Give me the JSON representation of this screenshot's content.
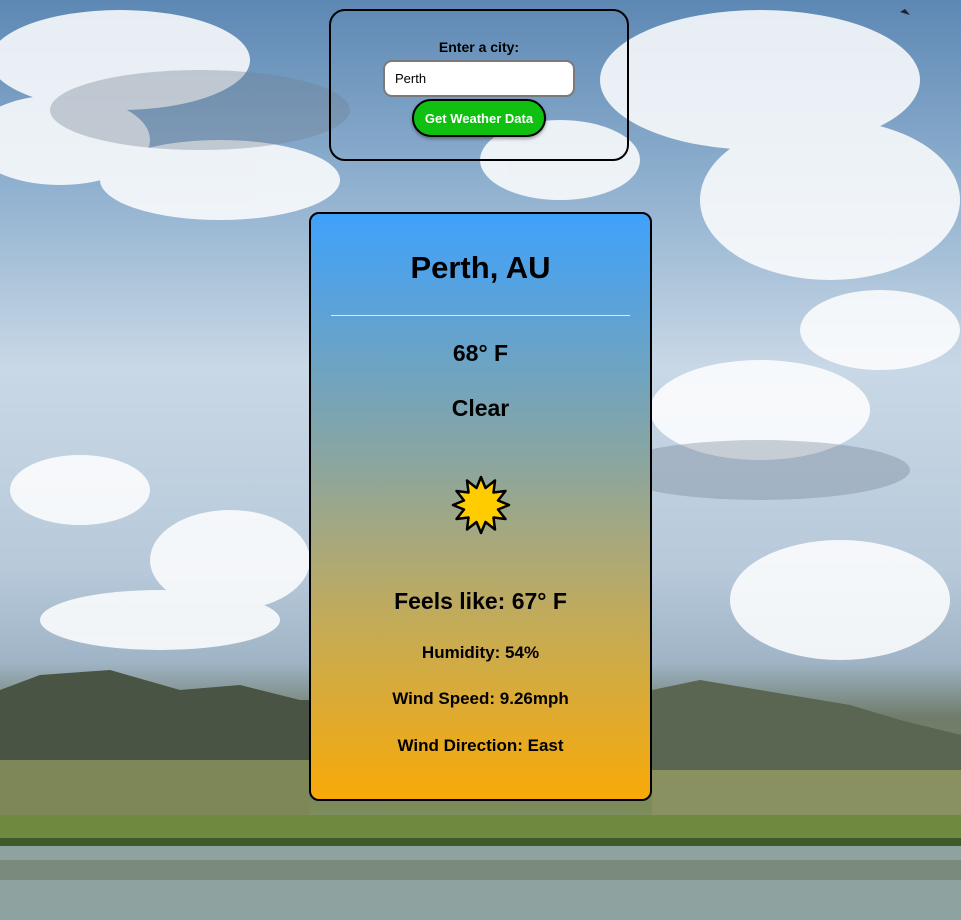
{
  "search": {
    "label": "Enter a city:",
    "value": "Perth",
    "button_label": "Get Weather Data"
  },
  "weather": {
    "location": "Perth, AU",
    "temperature": "68° F",
    "condition": "Clear",
    "icon": "sun-icon",
    "feels_like": "Feels like: 67° F",
    "humidity": "Humidity: 54%",
    "wind_speed": "Wind Speed: 9.26mph",
    "wind_direction": "Wind Direction: East"
  },
  "colors": {
    "button_green": "#10c010",
    "card_top": "#3fa1fb",
    "card_bottom": "#f8aa07",
    "sun_fill": "#ffcc00"
  }
}
